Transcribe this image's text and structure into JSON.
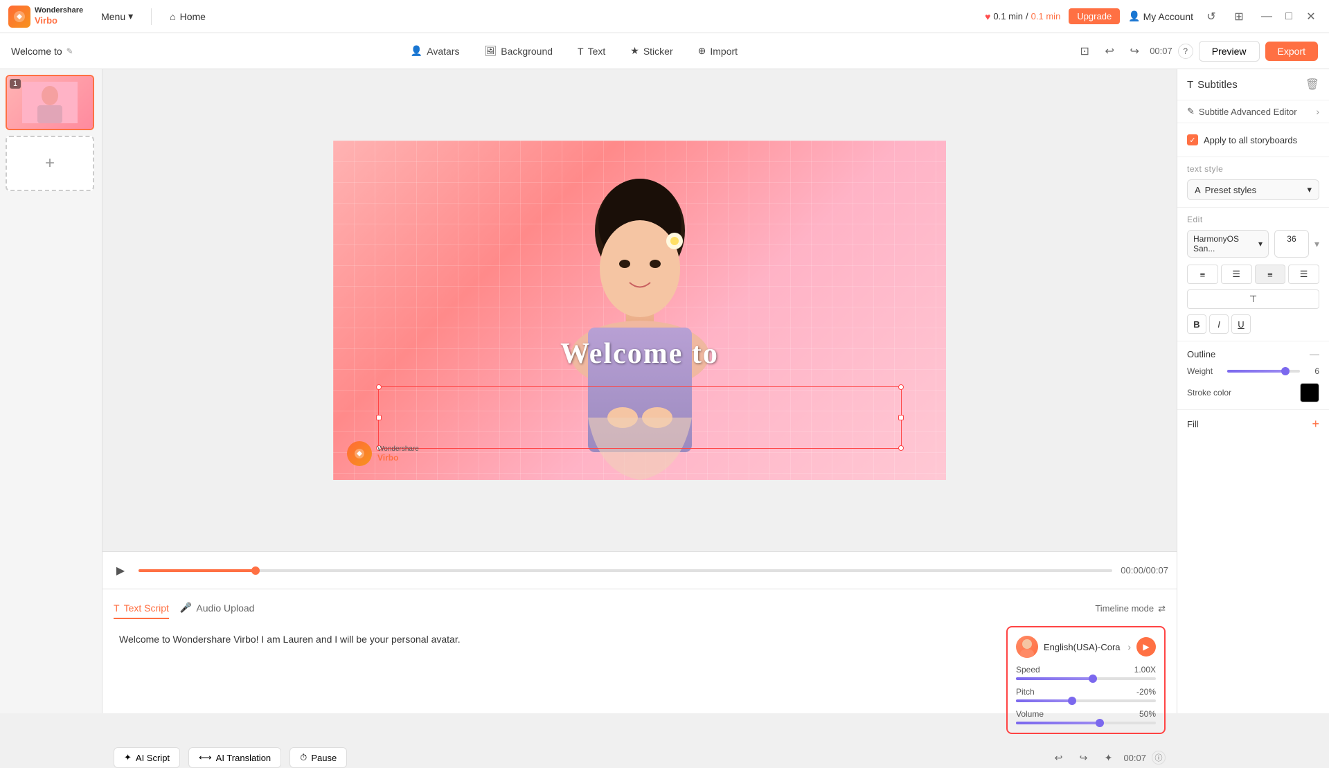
{
  "app": {
    "name": "Wondershare Virbo",
    "logo_text": "WV"
  },
  "topbar": {
    "menu_label": "Menu",
    "home_label": "Home",
    "time_used": "0.1 min",
    "time_total": "0.1 min",
    "upgrade_label": "Upgrade",
    "my_account_label": "My Account"
  },
  "toolbar": {
    "project_title": "Welcome to",
    "avatars_label": "Avatars",
    "background_label": "Background",
    "text_label": "Text",
    "sticker_label": "Sticker",
    "import_label": "Import",
    "time_display": "00:07",
    "preview_label": "Preview",
    "export_label": "Export"
  },
  "canvas": {
    "welcome_text": "Welcome to",
    "watermark_brand": "Wondershare",
    "watermark_product": "Virbo",
    "time_current": "00:00",
    "time_total": "00:07"
  },
  "script": {
    "tab_text_script": "Text Script",
    "tab_audio_upload": "Audio Upload",
    "timeline_mode_label": "Timeline mode",
    "content": "Welcome to Wondershare Virbo! I am Lauren and I will be your personal avatar.",
    "ai_script_label": "AI Script",
    "ai_translation_label": "AI Translation",
    "pause_label": "Pause",
    "time_display": "00:07"
  },
  "voice_panel": {
    "voice_name": "English(USA)-Cora",
    "speed_label": "Speed",
    "speed_value": "1.00X",
    "pitch_label": "Pitch",
    "pitch_value": "-20%",
    "volume_label": "Volume",
    "volume_value": "50%",
    "speed_fill": "55%",
    "pitch_fill": "40%",
    "volume_fill": "60%"
  },
  "right_panel": {
    "subtitles_label": "Subtitles",
    "subtitle_editor_label": "Subtitle Advanced Editor",
    "apply_all_label": "Apply to all storyboards",
    "text_style_label": "text style",
    "preset_styles_label": "Preset styles",
    "edit_label": "Edit",
    "font_family": "HarmonyOS San...",
    "font_size": "36",
    "outline_label": "Outline",
    "weight_label": "Weight",
    "weight_value": "6",
    "stroke_color_label": "Stroke color",
    "fill_label": "Fill"
  }
}
